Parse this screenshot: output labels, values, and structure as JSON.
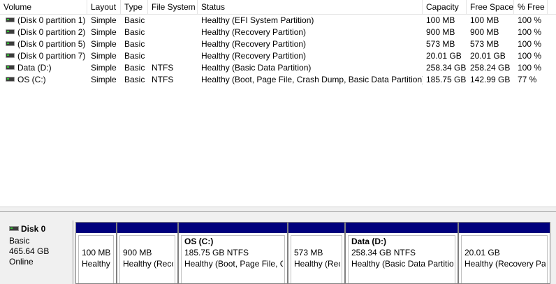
{
  "columns": [
    "Volume",
    "Layout",
    "Type",
    "File System",
    "Status",
    "Capacity",
    "Free Space",
    "% Free"
  ],
  "volumes": [
    {
      "name": "(Disk 0 partition 1)",
      "layout": "Simple",
      "type": "Basic",
      "fs": "",
      "status": "Healthy (EFI System Partition)",
      "capacity": "100 MB",
      "free": "100 MB",
      "pct": "100 %"
    },
    {
      "name": "(Disk 0 partition 2)",
      "layout": "Simple",
      "type": "Basic",
      "fs": "",
      "status": "Healthy (Recovery Partition)",
      "capacity": "900 MB",
      "free": "900 MB",
      "pct": "100 %"
    },
    {
      "name": "(Disk 0 partition 5)",
      "layout": "Simple",
      "type": "Basic",
      "fs": "",
      "status": "Healthy (Recovery Partition)",
      "capacity": "573 MB",
      "free": "573 MB",
      "pct": "100 %"
    },
    {
      "name": "(Disk 0 partition 7)",
      "layout": "Simple",
      "type": "Basic",
      "fs": "",
      "status": "Healthy (Recovery Partition)",
      "capacity": "20.01 GB",
      "free": "20.01 GB",
      "pct": "100 %"
    },
    {
      "name": "Data (D:)",
      "layout": "Simple",
      "type": "Basic",
      "fs": "NTFS",
      "status": "Healthy (Basic Data Partition)",
      "capacity": "258.34 GB",
      "free": "258.24 GB",
      "pct": "100 %"
    },
    {
      "name": "OS (C:)",
      "layout": "Simple",
      "type": "Basic",
      "fs": "NTFS",
      "status": "Healthy (Boot, Page File, Crash Dump, Basic Data Partition)",
      "capacity": "185.75 GB",
      "free": "142.99 GB",
      "pct": "77 %"
    }
  ],
  "disk": {
    "name": "Disk 0",
    "type": "Basic",
    "size": "465.64 GB",
    "state": "Online",
    "icon": "disk-icon"
  },
  "partitions": [
    {
      "title": "",
      "size": "100 MB",
      "status": "Healthy"
    },
    {
      "title": "",
      "size": "900 MB",
      "status": "Healthy (Reco"
    },
    {
      "title": "OS  (C:)",
      "size": "185.75 GB NTFS",
      "status": "Healthy (Boot, Page File, C"
    },
    {
      "title": "",
      "size": "573 MB",
      "status": "Healthy (Rec"
    },
    {
      "title": "Data  (D:)",
      "size": "258.34 GB NTFS",
      "status": "Healthy (Basic Data Partitior"
    },
    {
      "title": "",
      "size": "20.01 GB",
      "status": "Healthy (Recovery Par"
    }
  ],
  "colors": {
    "partition_bar": "#00007d",
    "pane_bg": "#f0f0f0"
  }
}
